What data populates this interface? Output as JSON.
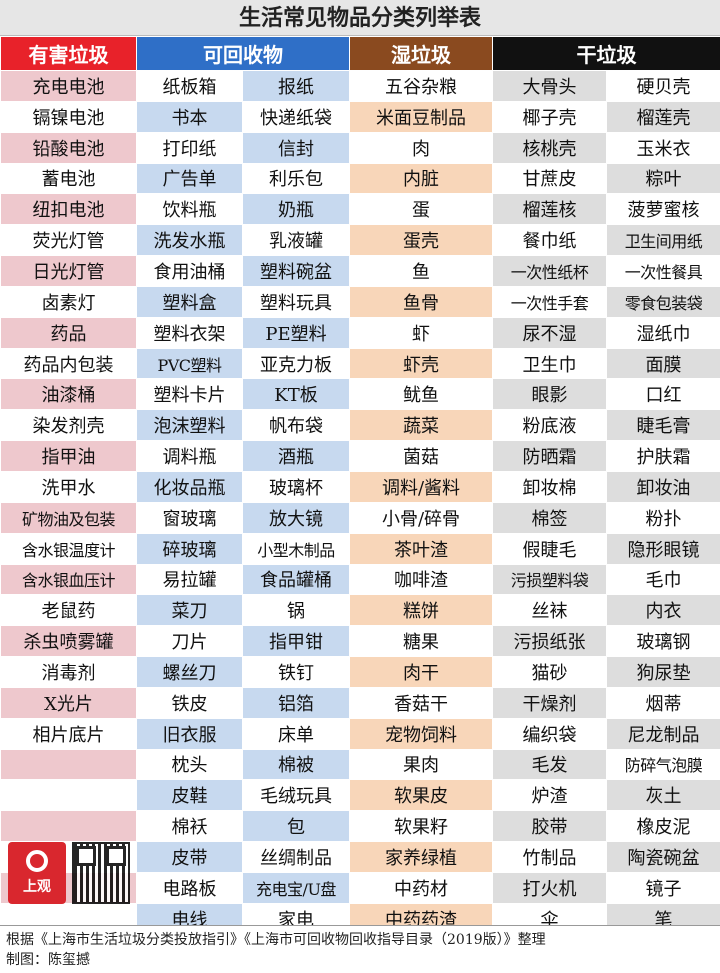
{
  "title": "生活常见物品分类列举表",
  "headers": {
    "hazardous": "有害垃圾",
    "recyclable": "可回收物",
    "wet": "湿垃圾",
    "dry": "干垃圾"
  },
  "rows": [
    [
      "充电电池",
      "纸板箱",
      "报纸",
      "五谷杂粮",
      "大骨头",
      "硬贝壳"
    ],
    [
      "镉镍电池",
      "书本",
      "快递纸袋",
      "米面豆制品",
      "椰子壳",
      "榴莲壳"
    ],
    [
      "铅酸电池",
      "打印纸",
      "信封",
      "肉",
      "核桃壳",
      "玉米衣"
    ],
    [
      "蓄电池",
      "广告单",
      "利乐包",
      "内脏",
      "甘蔗皮",
      "粽叶"
    ],
    [
      "纽扣电池",
      "饮料瓶",
      "奶瓶",
      "蛋",
      "榴莲核",
      "菠萝蜜核"
    ],
    [
      "荧光灯管",
      "洗发水瓶",
      "乳液罐",
      "蛋壳",
      "餐巾纸",
      "卫生间用纸"
    ],
    [
      "日光灯管",
      "食用油桶",
      "塑料碗盆",
      "鱼",
      "一次性纸杯",
      "一次性餐具"
    ],
    [
      "卤素灯",
      "塑料盒",
      "塑料玩具",
      "鱼骨",
      "一次性手套",
      "零食包装袋"
    ],
    [
      "药品",
      "塑料衣架",
      "PE塑料",
      "虾",
      "尿不湿",
      "湿纸巾"
    ],
    [
      "药品内包装",
      "PVC塑料",
      "亚克力板",
      "虾壳",
      "卫生巾",
      "面膜"
    ],
    [
      "油漆桶",
      "塑料卡片",
      "KT板",
      "鱿鱼",
      "眼影",
      "口红"
    ],
    [
      "染发剂壳",
      "泡沫塑料",
      "帆布袋",
      "蔬菜",
      "粉底液",
      "睫毛膏"
    ],
    [
      "指甲油",
      "调料瓶",
      "酒瓶",
      "菌菇",
      "防晒霜",
      "护肤霜"
    ],
    [
      "洗甲水",
      "化妆品瓶",
      "玻璃杯",
      "调料/酱料",
      "卸妆棉",
      "卸妆油"
    ],
    [
      "矿物油及包装",
      "窗玻璃",
      "放大镜",
      "小骨/碎骨",
      "棉签",
      "粉扑"
    ],
    [
      "含水银温度计",
      "碎玻璃",
      "小型木制品",
      "茶叶渣",
      "假睫毛",
      "隐形眼镜"
    ],
    [
      "含水银血压计",
      "易拉罐",
      "食品罐桶",
      "咖啡渣",
      "污损塑料袋",
      "毛巾"
    ],
    [
      "老鼠药",
      "菜刀",
      "锅",
      "糕饼",
      "丝袜",
      "内衣"
    ],
    [
      "杀虫喷雾罐",
      "刀片",
      "指甲钳",
      "糖果",
      "污损纸张",
      "玻璃钢"
    ],
    [
      "消毒剂",
      "螺丝刀",
      "铁钉",
      "肉干",
      "猫砂",
      "狗尿垫"
    ],
    [
      "X光片",
      "铁皮",
      "铝箔",
      "香菇干",
      "干燥剂",
      "烟蒂"
    ],
    [
      "相片底片",
      "旧衣服",
      "床单",
      "宠物饲料",
      "编织袋",
      "尼龙制品"
    ],
    [
      "",
      "枕头",
      "棉被",
      "果肉",
      "毛发",
      "防碎气泡膜"
    ],
    [
      "",
      "皮鞋",
      "毛绒玩具",
      "软果皮",
      "炉渣",
      "灰土"
    ],
    [
      "",
      "棉袄",
      "包",
      "软果籽",
      "胶带",
      "橡皮泥"
    ],
    [
      "",
      "皮带",
      "丝绸制品",
      "家养绿植",
      "竹制品",
      "陶瓷碗盆"
    ],
    [
      "",
      "电路板",
      "充电宝/U盘",
      "中药材",
      "打火机",
      "镜子"
    ],
    [
      "",
      "电线",
      "家电",
      "中药药渣",
      "伞",
      "笔"
    ]
  ],
  "logo": {
    "text": "上观"
  },
  "footer": {
    "line1": "根据《上海市生活垃圾分类投放指引》《上海市可回收物回收指导目录（2019版）》整理",
    "line2": "制图：陈玺撼"
  }
}
